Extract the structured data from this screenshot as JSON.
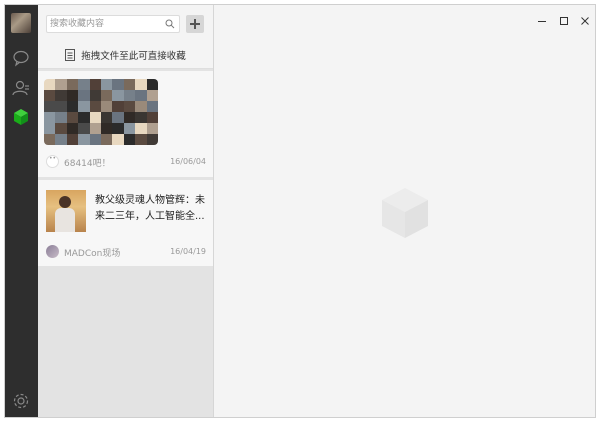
{
  "search": {
    "placeholder": "搜索收藏内容"
  },
  "dropzone": {
    "label": "拖拽文件至此可直接收藏"
  },
  "nav": {
    "icons": [
      "chat-icon",
      "contacts-icon",
      "favorites-cube-icon",
      "settings-icon"
    ],
    "active": "favorites-cube-icon",
    "active_color": "#1aad19"
  },
  "favorites": [
    {
      "title": "",
      "source": "68414吧！",
      "date": "16/06/04"
    },
    {
      "title_line1": "教父级灵魂人物管辉：未",
      "title_line2": "来二三年，人工智能全...",
      "source": "MADCon现场",
      "date": "16/04/19"
    }
  ],
  "window_controls": [
    "minimize-icon",
    "maximize-icon",
    "close-icon"
  ]
}
